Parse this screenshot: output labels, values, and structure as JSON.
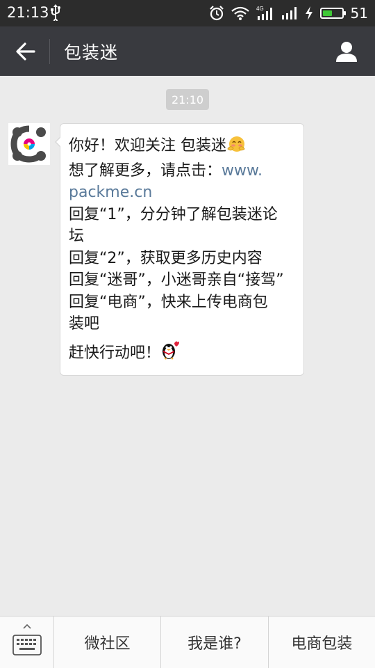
{
  "status_bar": {
    "time": "21:13",
    "signal_4g_label": "4G",
    "battery_level": 51,
    "battery_text": "51",
    "icons": [
      "usb-icon",
      "alarm-icon",
      "wifi-icon",
      "cell-signal-icon",
      "charging-icon",
      "battery-icon"
    ]
  },
  "header": {
    "title": "包装迷",
    "back_icon": "arrow-left-icon",
    "profile_icon": "person-icon"
  },
  "chat": {
    "timestamp": "21:10",
    "message": {
      "line1": "你好！欢迎关注 包装迷",
      "line2_prefix": "想了解更多，请点击：",
      "link_a": "www.",
      "link_b": "packme.cn",
      "line3a": "回复“1”，分分钟了解包装迷论",
      "line3b": "坛",
      "line4": "回复“2”，获取更多历史内容",
      "line5": "回复“迷哥”，小迷哥亲自“接驾”",
      "line6a": "回复“电商”，快来上传电商包",
      "line6b": "装吧",
      "line7": "赶快行动吧！"
    }
  },
  "bottom_menu": {
    "keyboard_icon": "keyboard-icon",
    "items": [
      {
        "label": "微社区"
      },
      {
        "label": "我是谁?"
      },
      {
        "label": "电商包装"
      }
    ]
  },
  "colors": {
    "status_bar_bg": "#2c2c2c",
    "title_bar_bg": "#393a3f",
    "chat_bg": "#ebebeb",
    "link": "#5a7a9a",
    "battery_fill": "#3fc836"
  }
}
